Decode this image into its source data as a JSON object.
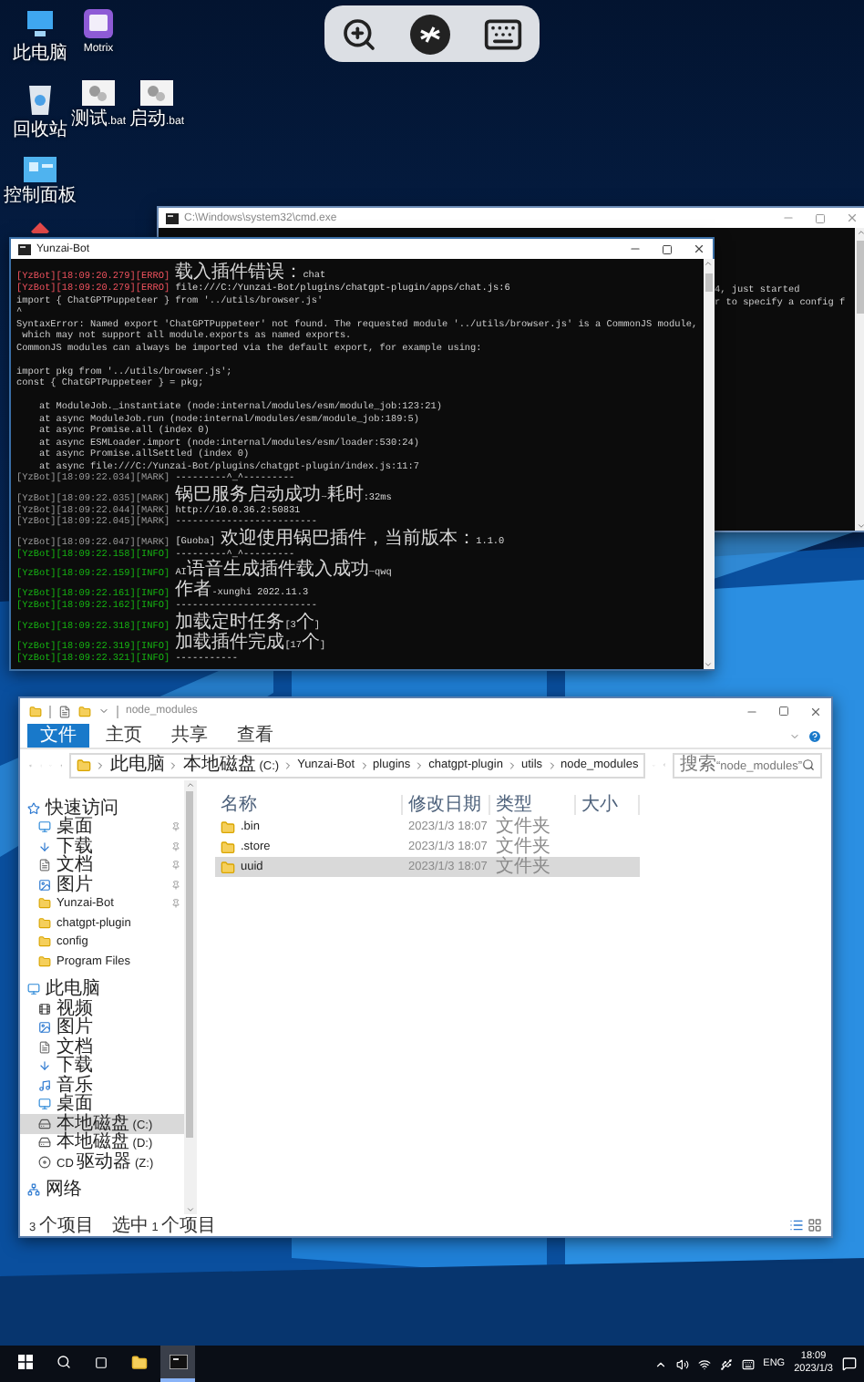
{
  "remote_toolbar": {
    "buttons": [
      {
        "kind": "zoom"
      },
      {
        "kind": "remote"
      },
      {
        "kind": "keyboard"
      }
    ]
  },
  "desktop_icon_rows": [
    [
      {
        "kind": "computer",
        "label": "此电脑"
      },
      {
        "kind": "app",
        "label": "Motrix"
      }
    ],
    [
      {
        "kind": "recycle-bin",
        "label": "回收站"
      },
      {
        "kind": "batch-file",
        "label": "测试.bat"
      },
      {
        "kind": "batch-file",
        "label": "启动.bat"
      }
    ],
    [
      {
        "kind": "control-panel",
        "label": "控制面板"
      }
    ],
    [
      {
        "kind": "tool"
      }
    ]
  ],
  "cmd_window": {
    "title": "C:\\Windows\\system32\\cmd.exe",
    "lines": [
      "4, just started",
      "r to specify a config f"
    ]
  },
  "console": {
    "title": "Yunzai-Bot",
    "lines": [
      {
        "kind": "error",
        "tag": "[YzBot][18:09:20.279][ERRO]",
        "text": "载入插件错误：chat"
      },
      {
        "kind": "error",
        "tag": "[YzBot][18:09:20.279][ERRO]",
        "text": "file:///C:/Yunzai-Bot/plugins/chatgpt-plugin/apps/chat.js:6"
      },
      {
        "kind": "plain",
        "text": "import { ChatGPTPuppeteer } from '../utils/browser.js'"
      },
      {
        "kind": "plain",
        "text": "^"
      },
      {
        "kind": "plain",
        "text": "SyntaxError: Named export 'ChatGPTPuppeteer' not found. The requested module '../utils/browser.js' is a CommonJS module,"
      },
      {
        "kind": "plain",
        "text": " which may not support all module.exports as named exports."
      },
      {
        "kind": "plain",
        "text": "CommonJS modules can always be imported via the default export, for example using:"
      },
      {
        "kind": "blank"
      },
      {
        "kind": "plain",
        "text": "import pkg from '../utils/browser.js';"
      },
      {
        "kind": "plain",
        "text": "const { ChatGPTPuppeteer } = pkg;"
      },
      {
        "kind": "blank"
      },
      {
        "kind": "plain",
        "text": "    at ModuleJob._instantiate (node:internal/modules/esm/module_job:123:21)"
      },
      {
        "kind": "plain",
        "text": "    at async ModuleJob.run (node:internal/modules/esm/module_job:189:5)"
      },
      {
        "kind": "plain",
        "text": "    at async Promise.all (index 0)"
      },
      {
        "kind": "plain",
        "text": "    at async ESMLoader.import (node:internal/modules/esm/loader:530:24)"
      },
      {
        "kind": "plain",
        "text": "    at async Promise.allSettled (index 0)"
      },
      {
        "kind": "plain",
        "text": "    at async file:///C:/Yunzai-Bot/plugins/chatgpt-plugin/index.js:11:7"
      },
      {
        "kind": "mark",
        "tag": "[YzBot][18:09:22.034][MARK]",
        "text": "---------^_^---------"
      },
      {
        "kind": "mark",
        "tag": "[YzBot][18:09:22.035][MARK]",
        "text": "锅巴服务启动成功~耗时:32ms"
      },
      {
        "kind": "mark",
        "tag": "[YzBot][18:09:22.044][MARK]",
        "text": "http://10.0.36.2:50831"
      },
      {
        "kind": "mark",
        "tag": "[YzBot][18:09:22.045][MARK]",
        "text": "-------------------------"
      },
      {
        "kind": "mark",
        "tag": "[YzBot][18:09:22.047][MARK]",
        "text": "[Guoba] 欢迎使用锅巴插件，当前版本：1.1.0"
      },
      {
        "kind": "info",
        "tag": "[YzBot][18:09:22.158][INFO]",
        "text": "---------^_^---------"
      },
      {
        "kind": "info",
        "tag": "[YzBot][18:09:22.159][INFO]",
        "text": "AI语音生成插件载入成功~qwq"
      },
      {
        "kind": "info",
        "tag": "[YzBot][18:09:22.161][INFO]",
        "text": "作者-xunghi 2022.11.3"
      },
      {
        "kind": "info",
        "tag": "[YzBot][18:09:22.162][INFO]",
        "text": "-------------------------"
      },
      {
        "kind": "info",
        "tag": "[YzBot][18:09:22.318][INFO]",
        "text": "加载定时任务[3个]"
      },
      {
        "kind": "info",
        "tag": "[YzBot][18:09:22.319][INFO]",
        "text": "加载插件完成[17个]"
      },
      {
        "kind": "info",
        "tag": "[YzBot][18:09:22.321][INFO]",
        "text": "-----------"
      }
    ]
  },
  "explorer": {
    "title": "node_modules",
    "ribbon_tabs": [
      {
        "label": "文件",
        "selected": true
      },
      {
        "label": "主页",
        "selected": false
      },
      {
        "label": "共享",
        "selected": false
      },
      {
        "label": "查看",
        "selected": false
      }
    ],
    "breadcrumb": [
      "此电脑",
      "本地磁盘 (C:)",
      "Yunzai-Bot",
      "plugins",
      "chatgpt-plugin",
      "utils",
      "node_modules"
    ],
    "search": {
      "placeholder": "搜索“node_modules”"
    },
    "sidebar": [
      {
        "kind": "quick-access",
        "label": "快速访问",
        "selected": false,
        "children": [
          {
            "kind": "desktop",
            "label": "桌面",
            "selected": false,
            "pinned": true
          },
          {
            "kind": "download",
            "label": "下载",
            "selected": false,
            "pinned": true
          },
          {
            "kind": "documents",
            "label": "文档",
            "selected": false,
            "pinned": true
          },
          {
            "kind": "pictures",
            "label": "图片",
            "selected": false,
            "pinned": true
          },
          {
            "kind": "folder",
            "label": "Yunzai-Bot",
            "selected": false,
            "pinned": true
          },
          {
            "kind": "folder",
            "label": "chatgpt-plugin",
            "selected": false,
            "pinned": false
          },
          {
            "kind": "folder",
            "label": "config",
            "selected": false,
            "pinned": false
          },
          {
            "kind": "folder",
            "label": "Program Files",
            "selected": false,
            "pinned": false
          }
        ]
      },
      {
        "kind": "computer",
        "label": "此电脑",
        "selected": false,
        "children": [
          {
            "kind": "videos",
            "label": "视频",
            "selected": false
          },
          {
            "kind": "pictures",
            "label": "图片",
            "selected": false
          },
          {
            "kind": "documents",
            "label": "文档",
            "selected": false
          },
          {
            "kind": "download",
            "label": "下载",
            "selected": false
          },
          {
            "kind": "music",
            "label": "音乐",
            "selected": false
          },
          {
            "kind": "desktop",
            "label": "桌面",
            "selected": false
          },
          {
            "kind": "drive",
            "label": "本地磁盘 (C:)",
            "selected": true
          },
          {
            "kind": "drive",
            "label": "本地磁盘 (D:)",
            "selected": false
          },
          {
            "kind": "cd",
            "label": "CD 驱动器 (Z:)",
            "selected": false
          }
        ]
      },
      {
        "kind": "network",
        "label": "网络",
        "selected": false
      }
    ],
    "columns": [
      "名称",
      "修改日期",
      "类型",
      "大小"
    ],
    "files": [
      {
        "name": ".bin",
        "modified": "2023/1/3 18:07",
        "type": "文件夹",
        "selected": false
      },
      {
        "name": ".store",
        "modified": "2023/1/3 18:07",
        "type": "文件夹",
        "selected": false
      },
      {
        "name": "uuid",
        "modified": "2023/1/3 18:07",
        "type": "文件夹",
        "selected": true
      }
    ],
    "status": {
      "count": "3 个项目",
      "selection": "选中 1 个项目"
    }
  },
  "taskbar": {
    "apps": [
      {
        "kind": "explorer",
        "active": false
      },
      {
        "kind": "terminal",
        "active": true
      }
    ],
    "tray": {
      "language": "ENG",
      "time": "18:09",
      "date": "2023/1/3"
    }
  }
}
